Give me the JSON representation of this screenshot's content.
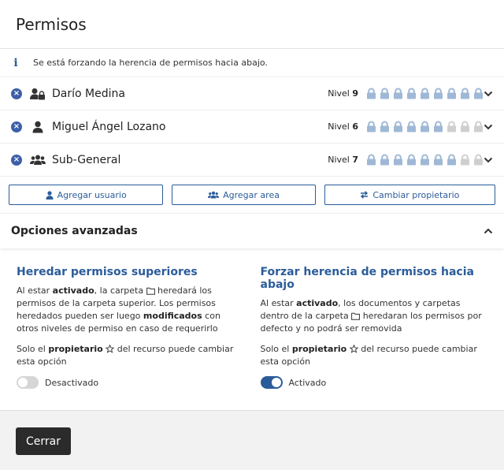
{
  "modal": {
    "title": "Permisos"
  },
  "info": {
    "text": "Se está forzando la herencia de permisos hacia abajo."
  },
  "permissions": [
    {
      "name": "Darío Medina",
      "icon": "user-lock-icon",
      "level_label": "Nivel",
      "level": "9",
      "level_value": 9,
      "max_level": 9
    },
    {
      "name": "Miguel Ángel Lozano",
      "icon": "user-icon",
      "level_label": "Nivel",
      "level": "6",
      "level_value": 6,
      "max_level": 9
    },
    {
      "name": "Sub-General",
      "icon": "users-icon",
      "level_label": "Nivel",
      "level": "7",
      "level_value": 7,
      "max_level": 9
    }
  ],
  "actions": {
    "add_user": "Agregar usuario",
    "add_area": "Agregar area",
    "change_owner": "Cambiar propietario"
  },
  "advanced": {
    "title": "Opciones avanzadas",
    "inherit": {
      "title": "Heredar permisos superiores",
      "p1_a": "Al estar ",
      "p1_b": "activado",
      "p1_c": ", la carpeta ",
      "p1_d": " heredará los permisos de la carpeta superior. Los permisos heredados pueden ser luego ",
      "p1_e": "modificados",
      "p1_f": " con otros niveles de permiso en caso de requerirlo",
      "p2_a": "Solo el ",
      "p2_b": "propietario",
      "p2_c": " del recurso puede cambiar esta opción",
      "toggle_label": "Desactivado",
      "toggle_on": false
    },
    "force": {
      "title": "Forzar herencia de permisos hacia abajo",
      "p1_a": "Al estar ",
      "p1_b": "activado",
      "p1_c": ", los documentos y carpetas dentro de la carpeta ",
      "p1_d": " heredaran los permisos por defecto y no podrá ser removida",
      "p2_a": "Solo el ",
      "p2_b": "propietario",
      "p2_c": " del recurso puede cambiar esta opción",
      "toggle_label": "Activado",
      "toggle_on": true
    }
  },
  "footer": {
    "close": "Cerrar"
  },
  "colors": {
    "accent": "#2b5c9a",
    "lock_active": "#9fb8d6",
    "lock_inactive": "#cfcfcf",
    "remove": "#3e5fa8"
  }
}
